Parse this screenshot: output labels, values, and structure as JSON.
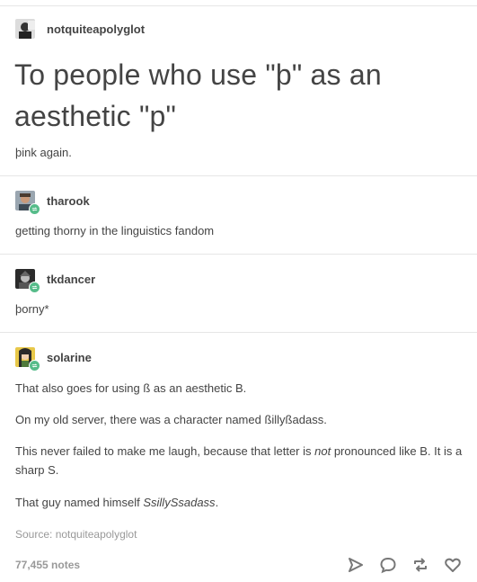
{
  "post": {
    "op_username": "notquiteapolyglot",
    "title": "To people who use \"þ\" as an aesthetic \"p\"",
    "op_body": "þink again."
  },
  "reblogs": [
    {
      "username": "tharook",
      "text": "getting thorny in the linguistics fandom"
    },
    {
      "username": "tkdancer",
      "text": "þorny*"
    },
    {
      "username": "solarine",
      "p1": "That also goes for using ß as an aesthetic B.",
      "p2": "On my old server, there was a character named ßillyßadass.",
      "p3_before": "This never failed to make me laugh, because that letter is ",
      "p3_em": "not",
      "p3_after": " pronounced like B. It is a sharp S.",
      "p4_before": "That guy named himself ",
      "p4_em": "SsillySsadass",
      "p4_after": "."
    }
  ],
  "footer": {
    "source_label": "Source:",
    "source_name": "notquiteapolyglot",
    "notes": "77,455 notes"
  },
  "icons": [
    "share-icon",
    "reply-icon",
    "reblog-icon",
    "like-icon"
  ],
  "colors": {
    "reblog_badge": "#56bc8a",
    "text": "#444444",
    "muted": "#999999"
  }
}
